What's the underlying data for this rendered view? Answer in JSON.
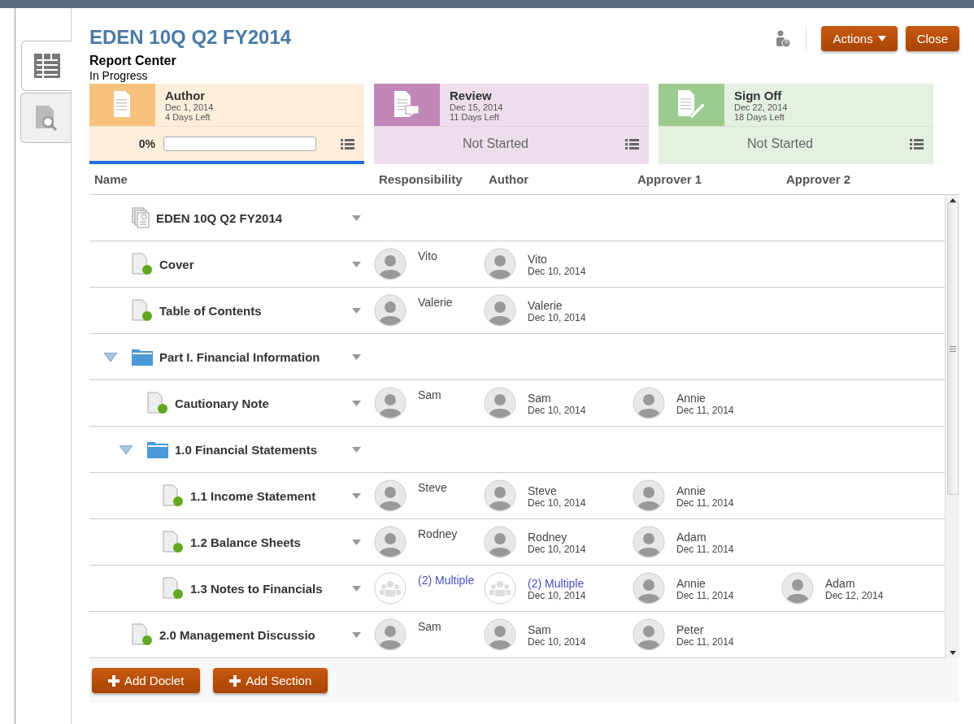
{
  "side_tabs": [
    {
      "kind": "grid",
      "selected": true
    },
    {
      "kind": "preview",
      "selected": false
    }
  ],
  "header": {
    "title": "EDEN 10Q Q2 FY2014",
    "subtitle": "Report Center",
    "status": "In Progress"
  },
  "toolbar": {
    "actions": "Actions",
    "close": "Close"
  },
  "stages": [
    {
      "kind": "author",
      "name": "Author",
      "date": "Dec 1, 2014",
      "days_left": "4 Days Left",
      "color": "#f7c27e",
      "selected": true,
      "percent": "0%",
      "level": 0
    },
    {
      "kind": "review",
      "name": "Review",
      "date": "Dec 15, 2014",
      "days_left": "11 Days Left",
      "color": "#c187b9",
      "selected": false,
      "state": "Not Started"
    },
    {
      "kind": "signoff",
      "name": "Sign Off",
      "date": "Dec 22, 2014",
      "days_left": "18 Days Left",
      "color": "#9dcb8f",
      "selected": false,
      "state": "Not Started"
    }
  ],
  "table": {
    "columns": [
      "Name",
      "Responsibility",
      "Author",
      "Approver 1",
      "Approver 2"
    ],
    "rows": [
      {
        "kind": "report",
        "name": "EDEN 10Q Q2 FY2014"
      },
      {
        "kind": "doclet",
        "name": "Cover",
        "responsibility": {
          "kind": "person",
          "name": "Vito"
        },
        "author": {
          "kind": "person",
          "name": "Vito",
          "date": "Dec 10, 2014"
        }
      },
      {
        "kind": "doclet",
        "name": "Table of Contents",
        "responsibility": {
          "kind": "person",
          "name": "Valerie"
        },
        "author": {
          "kind": "person",
          "name": "Valerie",
          "date": "Dec 10, 2014"
        }
      },
      {
        "kind": "section",
        "name": "Part I. Financial Information",
        "expanded": true,
        "children": [
          {
            "kind": "doclet",
            "name": "Cautionary Note",
            "responsibility": {
              "kind": "person",
              "name": "Sam"
            },
            "author": {
              "kind": "person",
              "name": "Sam",
              "date": "Dec 10, 2014"
            },
            "approver_1": {
              "kind": "person",
              "name": "Annie",
              "date": "Dec 11, 2014"
            }
          },
          {
            "kind": "section",
            "name": "1.0 Financial Statements",
            "expanded": true,
            "children": [
              {
                "kind": "doclet",
                "name": "1.1 Income Statement",
                "responsibility": {
                  "kind": "person",
                  "name": "Steve"
                },
                "author": {
                  "kind": "person",
                  "name": "Steve",
                  "date": "Dec 10, 2014"
                },
                "approver_1": {
                  "kind": "person",
                  "name": "Annie",
                  "date": "Dec 11, 2014"
                }
              },
              {
                "kind": "doclet",
                "name": "1.2 Balance Sheets",
                "responsibility": {
                  "kind": "person",
                  "name": "Rodney"
                },
                "author": {
                  "kind": "person",
                  "name": "Rodney",
                  "date": "Dec 10, 2014"
                },
                "approver_1": {
                  "kind": "person",
                  "name": "Adam",
                  "date": "Dec 11, 2014"
                }
              },
              {
                "kind": "doclet",
                "name": "1.3 Notes to Financials",
                "responsibility": {
                  "kind": "group",
                  "name": "(2) Multiple"
                },
                "author": {
                  "kind": "group",
                  "name": "(2) Multiple",
                  "date": "Dec 10, 2014"
                },
                "approver_1": {
                  "kind": "person",
                  "name": "Annie",
                  "date": "Dec 11, 2014"
                },
                "approver_2": {
                  "kind": "person",
                  "name": "Adam",
                  "date": "Dec 12, 2014"
                }
              }
            ]
          }
        ]
      },
      {
        "kind": "doclet",
        "name": "2.0 Management Discussio",
        "responsibility": {
          "kind": "person",
          "name": "Sam"
        },
        "author": {
          "kind": "person",
          "name": "Sam",
          "date": "Dec 10, 2014"
        },
        "approver_1": {
          "kind": "person",
          "name": "Peter",
          "date": "Dec 11, 2014"
        }
      }
    ]
  },
  "footer": {
    "buttons": [
      {
        "label": "Add Doclet"
      },
      {
        "label": "Add Section"
      }
    ]
  }
}
